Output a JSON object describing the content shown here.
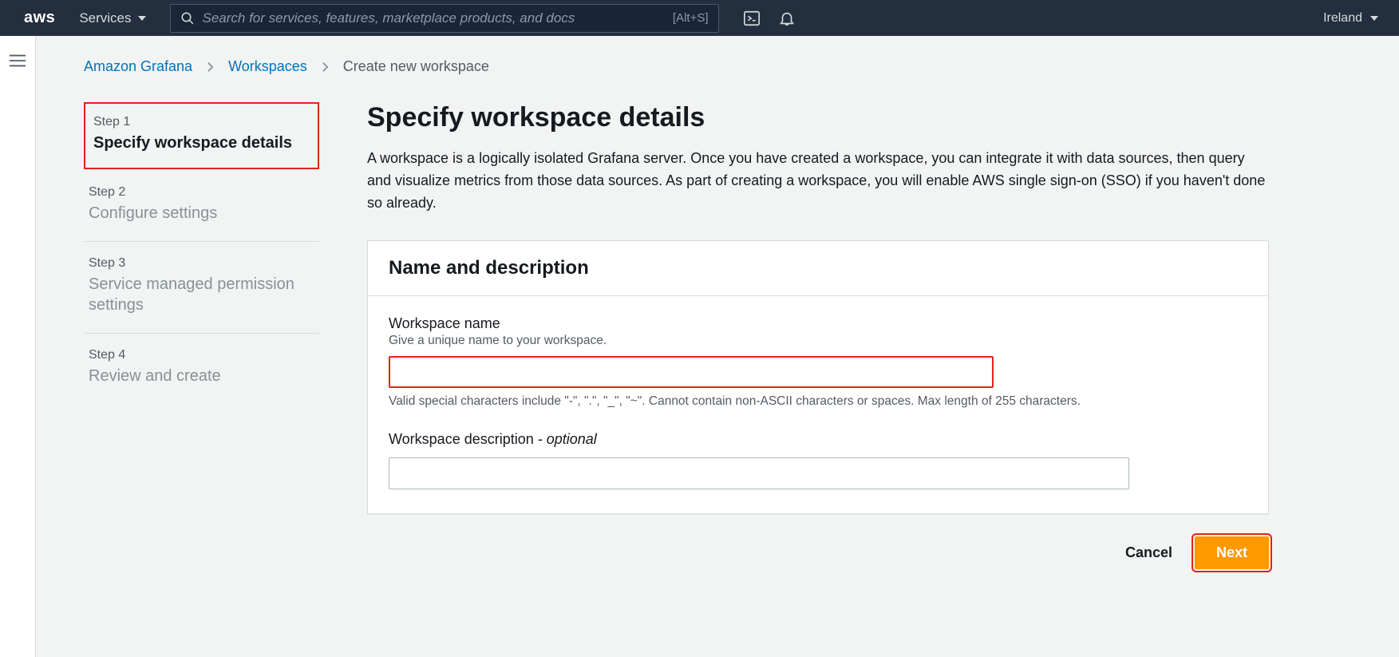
{
  "topbar": {
    "services_label": "Services",
    "search_placeholder": "Search for services, features, marketplace products, and docs",
    "shortcut": "[Alt+S]",
    "region": "Ireland"
  },
  "breadcrumb": {
    "root": "Amazon Grafana",
    "workspaces": "Workspaces",
    "current": "Create new workspace"
  },
  "steps": [
    {
      "label": "Step 1",
      "title": "Specify workspace details",
      "active": true
    },
    {
      "label": "Step 2",
      "title": "Configure settings",
      "active": false
    },
    {
      "label": "Step 3",
      "title": "Service managed permission settings",
      "active": false
    },
    {
      "label": "Step 4",
      "title": "Review and create",
      "active": false
    }
  ],
  "page": {
    "title": "Specify workspace details",
    "description": "A workspace is a logically isolated Grafana server. Once you have created a workspace, you can integrate it with data sources, then query and visualize metrics from those data sources. As part of creating a workspace, you will enable AWS single sign-on (SSO) if you haven't done so already."
  },
  "panel": {
    "title": "Name and description",
    "name_field": {
      "label": "Workspace name",
      "hint": "Give a unique name to your workspace.",
      "value": "",
      "help": "Valid special characters include \"-\", \".\", \"_\", \"~\". Cannot contain non-ASCII characters or spaces. Max length of 255 characters."
    },
    "desc_field": {
      "label_main": "Workspace description",
      "label_optional": " - optional",
      "value": ""
    }
  },
  "actions": {
    "cancel": "Cancel",
    "next": "Next"
  }
}
